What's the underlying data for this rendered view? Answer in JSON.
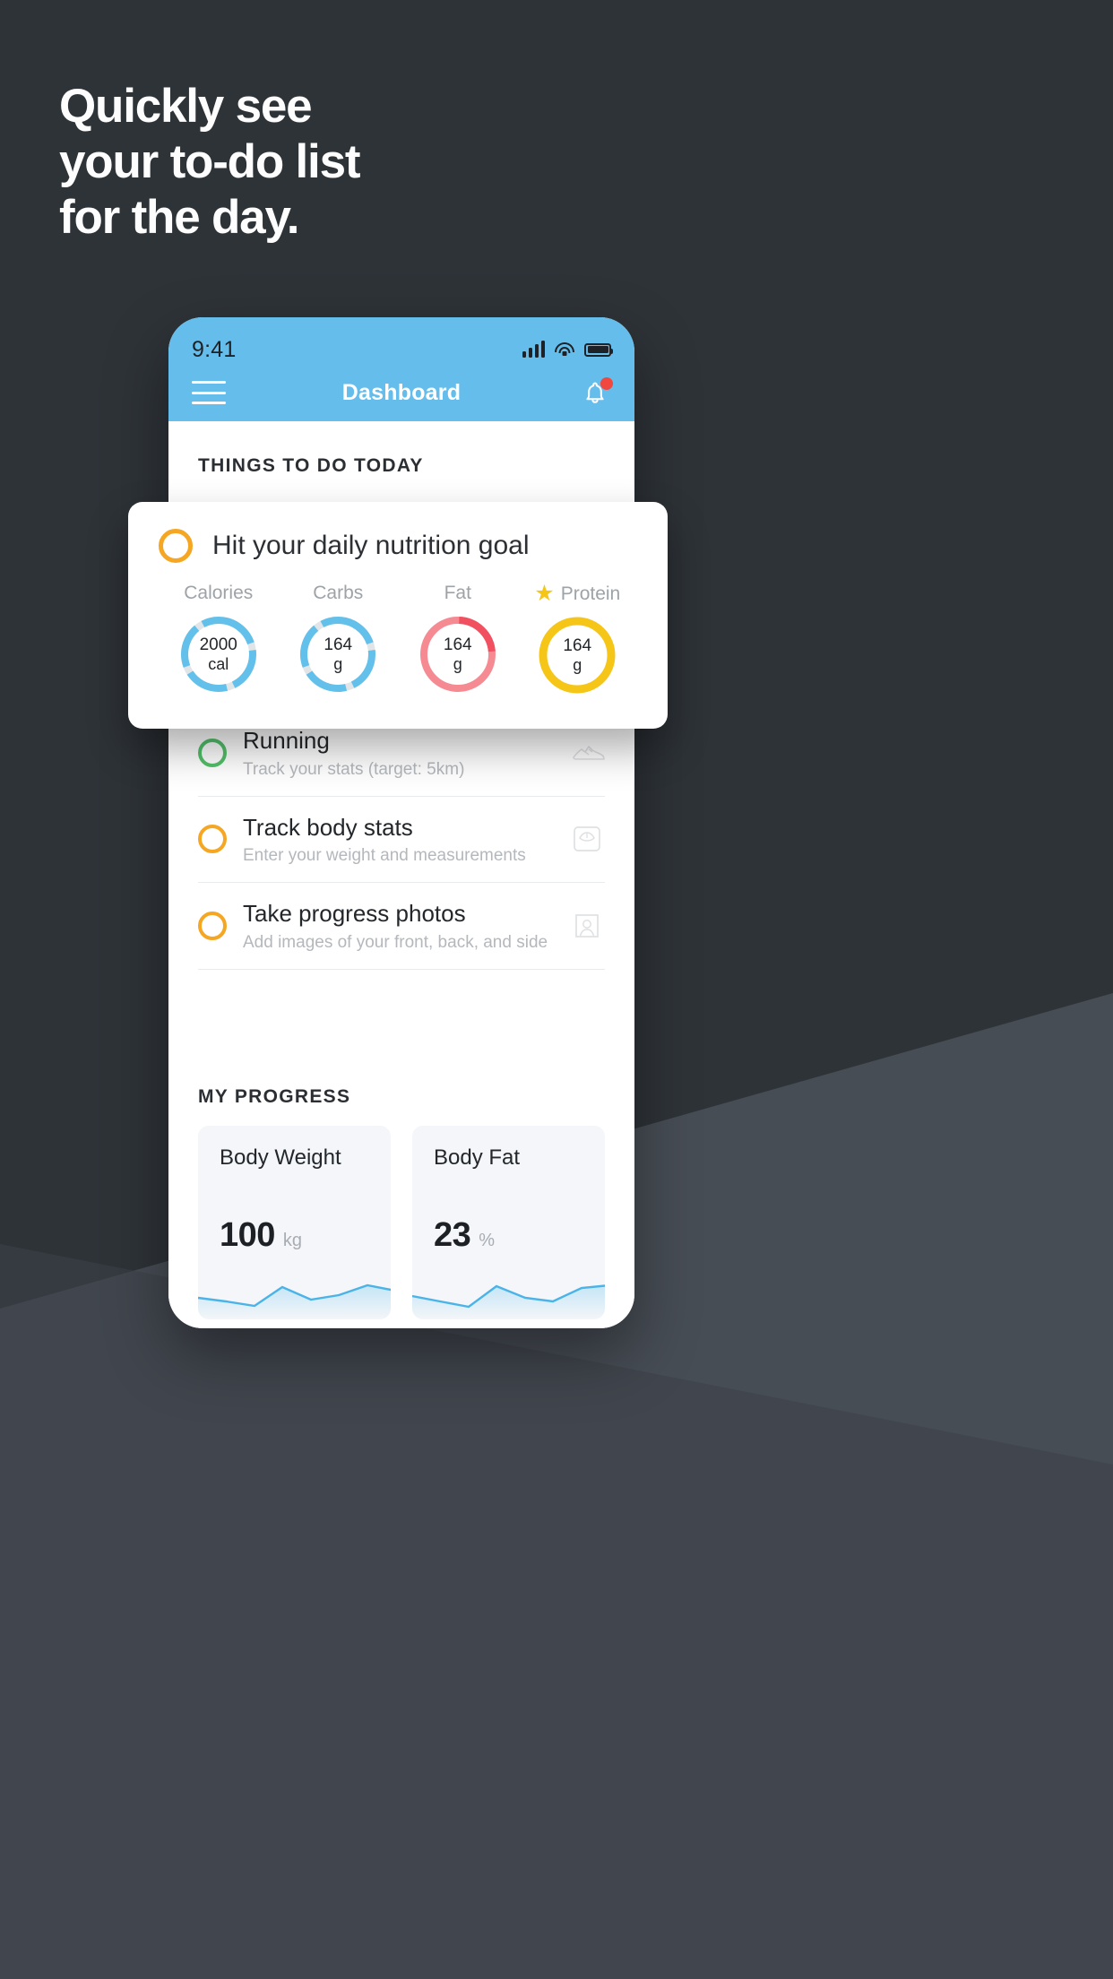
{
  "promo": {
    "headline_lines": [
      "Quickly see",
      "your to-do list",
      "for the day."
    ],
    "background_color": "#2e3338",
    "text_color": "#fdfdfd"
  },
  "phone": {
    "status_bar": {
      "time": "9:41",
      "signal_icon": "signal-bars-icon",
      "wifi_icon": "wifi-icon",
      "battery_icon": "battery-full-icon"
    },
    "nav": {
      "menu_icon": "hamburger-menu-icon",
      "title": "Dashboard",
      "bell_icon": "bell-icon",
      "bell_badge": "notification-dot",
      "accent_color": "#65bdec"
    },
    "todo_section": {
      "heading": "THINGS TO DO TODAY",
      "tasks": [
        {
          "title": "Running",
          "subtitle": "Track your stats (target: 5km)",
          "ring_color": "#52c16a",
          "icon": "running-shoe-icon"
        },
        {
          "title": "Track body stats",
          "subtitle": "Enter your weight and measurements",
          "ring_color": "#f5a623",
          "icon": "bathroom-scale-icon"
        },
        {
          "title": "Take progress photos",
          "subtitle": "Add images of your front, back, and side",
          "ring_color": "#f5a623",
          "icon": "person-photo-icon"
        }
      ]
    },
    "progress_section": {
      "heading": "MY PROGRESS",
      "cards": [
        {
          "title": "Body Weight",
          "value": "100",
          "unit": "kg"
        },
        {
          "title": "Body Fat",
          "value": "23",
          "unit": "%"
        }
      ]
    }
  },
  "nutrition_card": {
    "ring_color": "#f5a623",
    "title": "Hit your daily nutrition goal",
    "macros": [
      {
        "label": "Calories",
        "value": "2000",
        "unit": "cal",
        "color": "#62c0ea",
        "track": "#e2e5e8",
        "starred": false
      },
      {
        "label": "Carbs",
        "value": "164",
        "unit": "g",
        "color": "#62c0ea",
        "track": "#e2e5e8",
        "starred": false
      },
      {
        "label": "Fat",
        "value": "164",
        "unit": "g",
        "color": "#f58a93",
        "track": "#f0505f",
        "starred": false
      },
      {
        "label": "Protein",
        "value": "164",
        "unit": "g",
        "color": "#f5c518",
        "track": "#f5c518",
        "starred": true
      }
    ]
  },
  "chart_data": {
    "type": "line",
    "title": "My Progress sparklines",
    "series": [
      {
        "name": "Body Weight",
        "unit": "kg",
        "current": 100,
        "values": [
          52,
          44,
          30,
          62,
          40,
          52,
          68,
          58
        ]
      },
      {
        "name": "Body Fat",
        "unit": "%",
        "current": 23,
        "values": [
          50,
          38,
          28,
          66,
          44,
          56,
          70,
          60
        ]
      }
    ],
    "xlabel": "",
    "ylabel": "",
    "grid": false,
    "legend": "none"
  }
}
